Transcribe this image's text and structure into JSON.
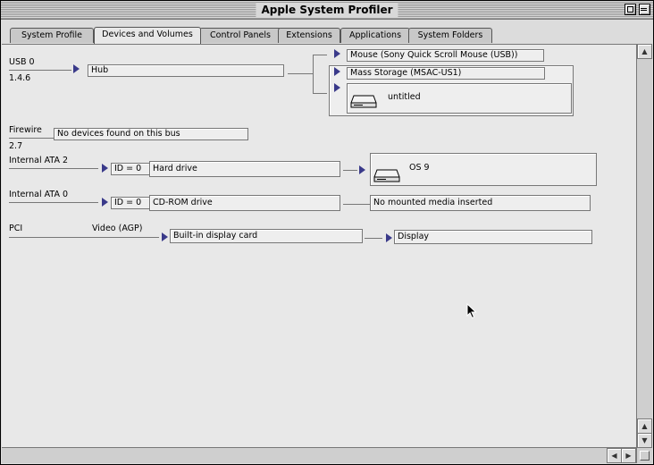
{
  "window": {
    "title": "Apple System Profiler"
  },
  "tabs": [
    {
      "label": "System Profile"
    },
    {
      "label": "Devices and Volumes"
    },
    {
      "label": "Control Panels"
    },
    {
      "label": "Extensions"
    },
    {
      "label": "Applications"
    },
    {
      "label": "System Folders"
    }
  ],
  "active_tab": "Devices and Volumes",
  "usb": {
    "bus_label": "USB 0",
    "version": "1.4.6",
    "hub_label": "Hub",
    "devices": [
      "Mouse (Sony Quick Scroll Mouse (USB))",
      "Mass Storage (MSAC-US1)"
    ],
    "volume_name": "untitled"
  },
  "firewire": {
    "bus_label": "Firewire",
    "version": "2.7",
    "status": "No devices found on this bus"
  },
  "ata2": {
    "bus_label": "Internal ATA 2",
    "id_label": "ID = 0",
    "device": "Hard drive",
    "volume_name": "OS 9"
  },
  "ata0": {
    "bus_label": "Internal ATA 0",
    "id_label": "ID = 0",
    "device": "CD-ROM drive",
    "media_status": "No mounted media inserted"
  },
  "pci": {
    "bus_label": "PCI",
    "slot_label": "Video (AGP)",
    "card": "Built-in display card",
    "display": "Display"
  },
  "colors": {
    "triangle": "#3a3a8a",
    "background": "#e8e8e8"
  },
  "icons": [
    "zoom-box-icon",
    "collapse-box-icon",
    "disclosure-triangle-icon",
    "disk-drive-icon",
    "arrow-cursor-icon"
  ]
}
